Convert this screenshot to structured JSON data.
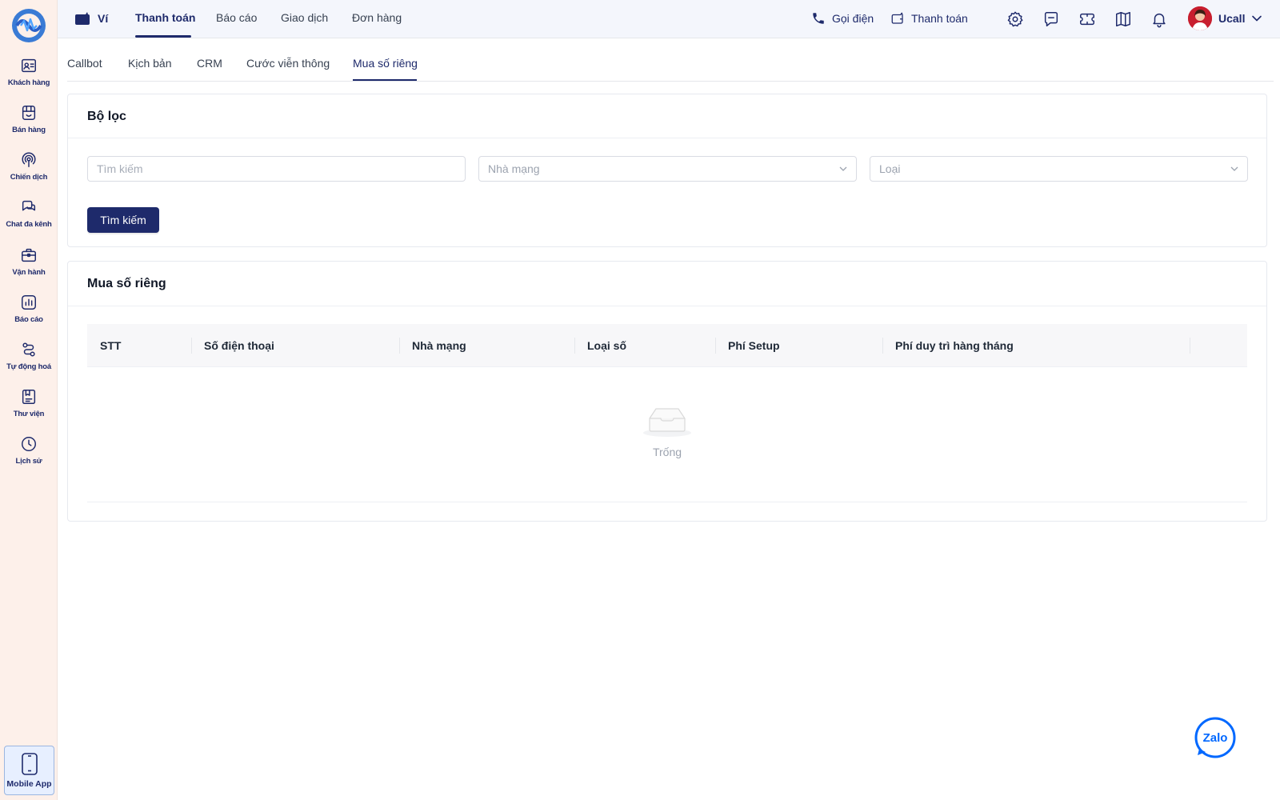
{
  "sidebar": {
    "items": [
      {
        "label": "Khách hàng",
        "icon": "contact-card-icon"
      },
      {
        "label": "Bán hàng",
        "icon": "store-icon"
      },
      {
        "label": "Chiến dịch",
        "icon": "broadcast-icon"
      },
      {
        "label": "Chat đa kênh",
        "icon": "chat-bubbles-icon"
      },
      {
        "label": "Vận hành",
        "icon": "briefcase-icon"
      },
      {
        "label": "Báo cáo",
        "icon": "bar-chart-icon"
      },
      {
        "label": "Tự động hoá",
        "icon": "automation-icon"
      },
      {
        "label": "Thư viện",
        "icon": "library-icon"
      },
      {
        "label": "Lịch sử",
        "icon": "clock-icon"
      }
    ],
    "mobile_app_label": "Mobile App"
  },
  "header": {
    "wallet_label": "Ví",
    "tabs": [
      "Thanh toán",
      "Báo cáo",
      "Giao dịch",
      "Đơn hàng"
    ],
    "active_tab": "Thanh toán",
    "call_label": "Gọi điện",
    "payment_label": "Thanh toán",
    "user_name": "Ucall"
  },
  "subtabs": {
    "items": [
      "Callbot",
      "Kịch bản",
      "CRM",
      "Cước viễn thông",
      "Mua số riêng"
    ],
    "active": "Mua số riêng"
  },
  "filter": {
    "title": "Bộ lọc",
    "search_placeholder": "Tìm kiếm",
    "carrier_placeholder": "Nhà mạng",
    "type_placeholder": "Loại",
    "search_button": "Tìm kiếm"
  },
  "table": {
    "title": "Mua số riêng",
    "columns": [
      "STT",
      "Số điện thoại",
      "Nhà mạng",
      "Loại số",
      "Phí Setup",
      "Phí duy trì hàng tháng"
    ],
    "rows": [],
    "empty_text": "Trống"
  },
  "zalo_label": "Zalo",
  "colors": {
    "primary": "#1e2a6b",
    "sidebar_bg": "#fdf0ea",
    "header_bg": "#f4f6fc"
  }
}
